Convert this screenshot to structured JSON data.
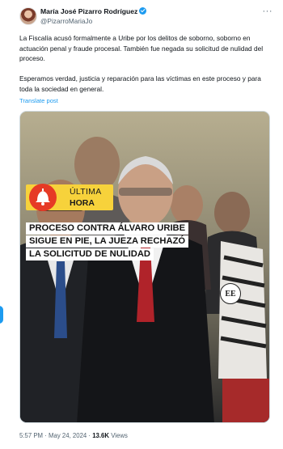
{
  "author": {
    "name": "María José Pizarro Rodríguez",
    "handle": "@PizarroMariaJo",
    "verified": true,
    "verified_color": "#1d9bf0"
  },
  "tweet": {
    "paragraphs": [
      "La Fiscalía acusó formalmente a Uribe por los delitos de soborno, soborno en actuación penal y fraude procesal. También fue negada su solicitud de nulidad del proceso.",
      "Esperamos verdad, justicia y reparación para las víctimas en este proceso y para toda la sociedad en general."
    ],
    "translate_label": "Translate post"
  },
  "media": {
    "banner": {
      "line1": "ÚLTIMA",
      "line2": "HORA",
      "color": "#f7d23b",
      "icon": "bell-icon"
    },
    "headline": [
      "PROCESO CONTRA ÁLVARO URIBE",
      "SIGUE EN PIE, LA JUEZA RECHAZÓ",
      "LA SOLICITUD DE NULIDAD"
    ],
    "logo_text": "EE"
  },
  "meta": {
    "time": "5:57 PM",
    "separator": "·",
    "date": "May 24, 2024",
    "views_count": "13.6K",
    "views_label": "Views"
  },
  "icons": {
    "more": "more-icon"
  }
}
